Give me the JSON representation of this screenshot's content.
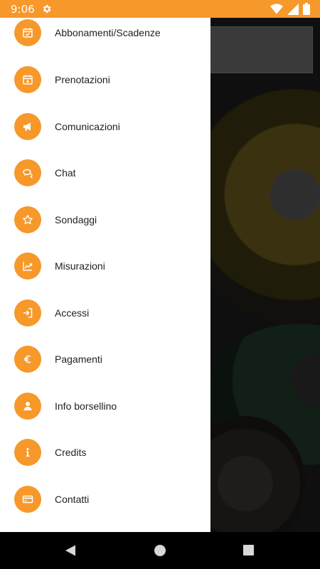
{
  "status_bar": {
    "time": "9:06",
    "background": "#f7982a",
    "icons": [
      "gear-icon",
      "wifi-icon",
      "signal-icon",
      "battery-icon"
    ]
  },
  "drawer": {
    "accent": "#f7982a",
    "items": [
      {
        "label": "Abbonamenti/Scadenze",
        "icon": "calendar-check-icon"
      },
      {
        "label": "Prenotazioni",
        "icon": "calendar-plus-icon"
      },
      {
        "label": "Comunicazioni",
        "icon": "megaphone-icon"
      },
      {
        "label": "Chat",
        "icon": "chat-bubbles-icon"
      },
      {
        "label": "Sondaggi",
        "icon": "star-icon"
      },
      {
        "label": "Misurazioni",
        "icon": "chart-line-icon"
      },
      {
        "label": "Accessi",
        "icon": "sign-in-icon"
      },
      {
        "label": "Pagamenti",
        "icon": "euro-icon"
      },
      {
        "label": "Info borsellino",
        "icon": "user-icon"
      },
      {
        "label": "Credits",
        "icon": "info-icon"
      },
      {
        "label": "Contatti",
        "icon": "credit-card-icon"
      }
    ]
  },
  "nav_bar": {
    "buttons": [
      "back-icon",
      "home-icon",
      "recents-icon"
    ]
  }
}
